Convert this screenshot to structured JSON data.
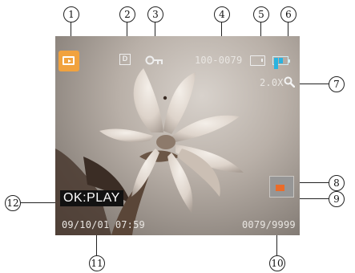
{
  "callouts": [
    "1",
    "2",
    "3",
    "4",
    "5",
    "6",
    "7",
    "8",
    "9",
    "10",
    "11",
    "12"
  ],
  "osd": {
    "file_number": "100-0079",
    "zoom": "2.0X",
    "ok_play": "OK:PLAY",
    "datetime": "09/10/01 07:59",
    "image_counter": "0079/9999",
    "dpof_letter": "D",
    "colors": {
      "play_icon": "#f1a23e",
      "battery": "#29b3e0",
      "nav_view_area": "#ea6c2a"
    },
    "icons": [
      "playback-mode-icon",
      "dpof-icon",
      "protect-key-icon",
      "memory-card-icon",
      "battery-icon",
      "magnifier-icon",
      "zoom-navigator-frame",
      "zoom-navigator-view"
    ],
    "battery_level": 1.0
  }
}
